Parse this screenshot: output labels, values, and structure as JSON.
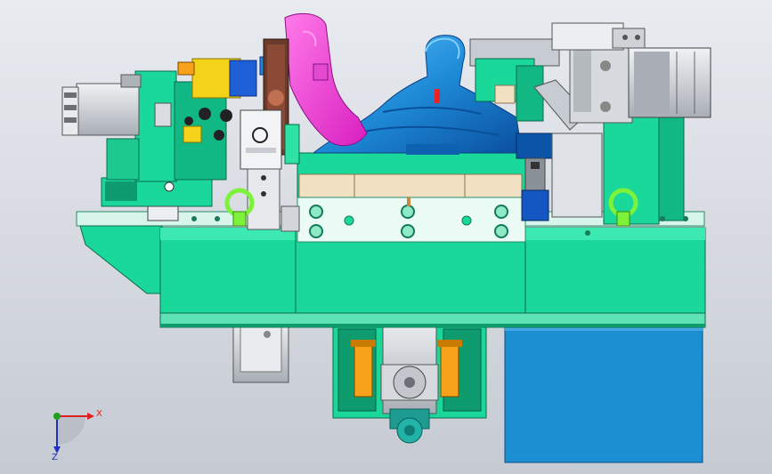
{
  "viewport": {
    "background_top": "#e6e9ee",
    "background_bottom": "#c8ccd4",
    "view_type": "3D CAD assembly view"
  },
  "model": {
    "colors": {
      "base_green": "#19d89a",
      "base_green_dark": "#0e9c6e",
      "mint": "#2fe3a6",
      "blue_part": "#1e90d8",
      "blue_dark": "#0b55a8",
      "magenta_part": "#f23ad6",
      "orange_part": "#f7a21a",
      "yellow_part": "#f5d21a",
      "beige_plate": "#f2e0c2",
      "lifting_ring": "#7cf23a",
      "steel_gray": "#cfd2d6",
      "motor_gray": "#b9bec6",
      "box_blue": "#1b8fd2",
      "teal_knob": "#22b2a8"
    }
  },
  "triad": {
    "x_label": "X",
    "z_label": "Z",
    "x_color": "#e02020",
    "y_color": "#20a020",
    "z_color": "#2030c0"
  }
}
